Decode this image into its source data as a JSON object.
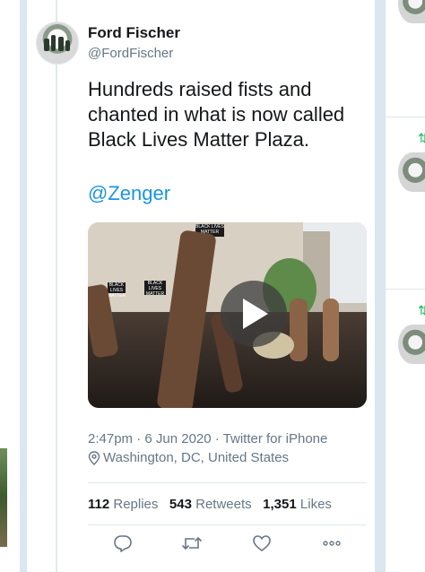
{
  "author": {
    "name": "Ford Fischer",
    "handle": "@FordFischer"
  },
  "tweet": {
    "text": "Hundreds raised fists and chanted in what is now called Black Lives Matter Plaza.",
    "mention": "@Zenger"
  },
  "media": {
    "type": "video",
    "sign_text": "BLACK LIVES MATTER"
  },
  "meta": {
    "time_source": "2:47pm · 6 Jun 2020 · Twitter for iPhone",
    "location": "Washington, DC, United States"
  },
  "stats": {
    "replies_count": "112",
    "replies_label": "Replies",
    "retweets_count": "543",
    "retweets_label": "Retweets",
    "likes_count": "1,351",
    "likes_label": "Likes"
  },
  "actions": [
    "reply-icon",
    "retweet-icon",
    "like-icon",
    "more-icon"
  ],
  "colors": {
    "link": "#1b95e0",
    "secondary_text": "#657786",
    "primary_text": "#14171a",
    "retweet_green": "#17bf63"
  }
}
